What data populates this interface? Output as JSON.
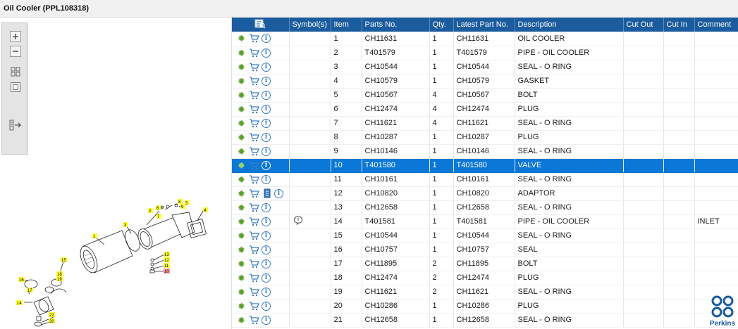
{
  "window": {
    "title": "Oil Cooler (PPL108318)"
  },
  "toolbox": {
    "tools": [
      {
        "name": "zoom-in-icon"
      },
      {
        "name": "zoom-out-icon"
      },
      {
        "name": "fit-all-icon"
      },
      {
        "name": "fit-window-icon"
      },
      {
        "name": "toggle-panel-icon"
      }
    ]
  },
  "diagram": {
    "callouts": [
      "1",
      "2",
      "3",
      "4",
      "5",
      "6",
      "7",
      "8",
      "9",
      "10",
      "11",
      "12",
      "13",
      "14",
      "15",
      "16",
      "17",
      "18",
      "19",
      "20",
      "21"
    ]
  },
  "grid": {
    "columns": {
      "symbols": "Symbol(s)",
      "item": "Item",
      "parts_no": "Parts No.",
      "qty": "Qty.",
      "latest": "Latest Part No.",
      "description": "Description",
      "cut_out": "Cut Out",
      "cut_in": "Cut In",
      "comment": "Comment"
    },
    "rows": [
      {
        "item": "1",
        "parts_no": "CH11631",
        "qty": "1",
        "latest": "CH11631",
        "description": "OIL COOLER",
        "comment": ""
      },
      {
        "item": "2",
        "parts_no": "T401579",
        "qty": "1",
        "latest": "T401579",
        "description": "PIPE - OIL COOLER",
        "comment": ""
      },
      {
        "item": "3",
        "parts_no": "CH10544",
        "qty": "1",
        "latest": "CH10544",
        "description": "SEAL - O RING",
        "comment": ""
      },
      {
        "item": "4",
        "parts_no": "CH10579",
        "qty": "1",
        "latest": "CH10579",
        "description": "GASKET",
        "comment": ""
      },
      {
        "item": "5",
        "parts_no": "CH10567",
        "qty": "4",
        "latest": "CH10567",
        "description": "BOLT",
        "comment": ""
      },
      {
        "item": "6",
        "parts_no": "CH12474",
        "qty": "4",
        "latest": "CH12474",
        "description": "PLUG",
        "comment": ""
      },
      {
        "item": "7",
        "parts_no": "CH11621",
        "qty": "4",
        "latest": "CH11621",
        "description": "SEAL - O RING",
        "comment": ""
      },
      {
        "item": "8",
        "parts_no": "CH10287",
        "qty": "1",
        "latest": "CH10287",
        "description": "PLUG",
        "comment": ""
      },
      {
        "item": "9",
        "parts_no": "CH10146",
        "qty": "1",
        "latest": "CH10146",
        "description": "SEAL - O RING",
        "comment": ""
      },
      {
        "item": "10",
        "parts_no": "T401580",
        "qty": "1",
        "latest": "T401580",
        "description": "VALVE",
        "comment": "",
        "selected": true
      },
      {
        "item": "11",
        "parts_no": "CH10161",
        "qty": "1",
        "latest": "CH10161",
        "description": "SEAL - O RING",
        "comment": ""
      },
      {
        "item": "12",
        "parts_no": "CH10820",
        "qty": "1",
        "latest": "CH10820",
        "description": "ADAPTOR",
        "comment": "",
        "extra_icon": "document-icon"
      },
      {
        "item": "13",
        "parts_no": "CH12658",
        "qty": "1",
        "latest": "CH12658",
        "description": "SEAL - O RING",
        "comment": ""
      },
      {
        "item": "14",
        "parts_no": "T401581",
        "qty": "1",
        "latest": "T401581",
        "description": "PIPE - OIL COOLER",
        "comment": "INLET",
        "symbol": "comment-bubble-icon"
      },
      {
        "item": "15",
        "parts_no": "CH10544",
        "qty": "1",
        "latest": "CH10544",
        "description": "SEAL - O RING",
        "comment": ""
      },
      {
        "item": "16",
        "parts_no": "CH10757",
        "qty": "1",
        "latest": "CH10757",
        "description": "SEAL",
        "comment": ""
      },
      {
        "item": "17",
        "parts_no": "CH11895",
        "qty": "2",
        "latest": "CH11895",
        "description": "BOLT",
        "comment": ""
      },
      {
        "item": "18",
        "parts_no": "CH12474",
        "qty": "2",
        "latest": "CH12474",
        "description": "PLUG",
        "comment": ""
      },
      {
        "item": "19",
        "parts_no": "CH11621",
        "qty": "2",
        "latest": "CH11621",
        "description": "SEAL - O RING",
        "comment": ""
      },
      {
        "item": "20",
        "parts_no": "CH10286",
        "qty": "1",
        "latest": "CH10286",
        "description": "PLUG",
        "comment": ""
      },
      {
        "item": "21",
        "parts_no": "CH12658",
        "qty": "1",
        "latest": "CH12658",
        "description": "SEAL - O RING",
        "comment": ""
      }
    ]
  },
  "brand": {
    "name": "Perkins",
    "color": "#1a5c9e"
  },
  "colors": {
    "header_bg": "#1a5c9e",
    "selected_row": "#0b77d6",
    "gear_green": "#5aa02c",
    "callout_yellow": "#ffff33"
  }
}
